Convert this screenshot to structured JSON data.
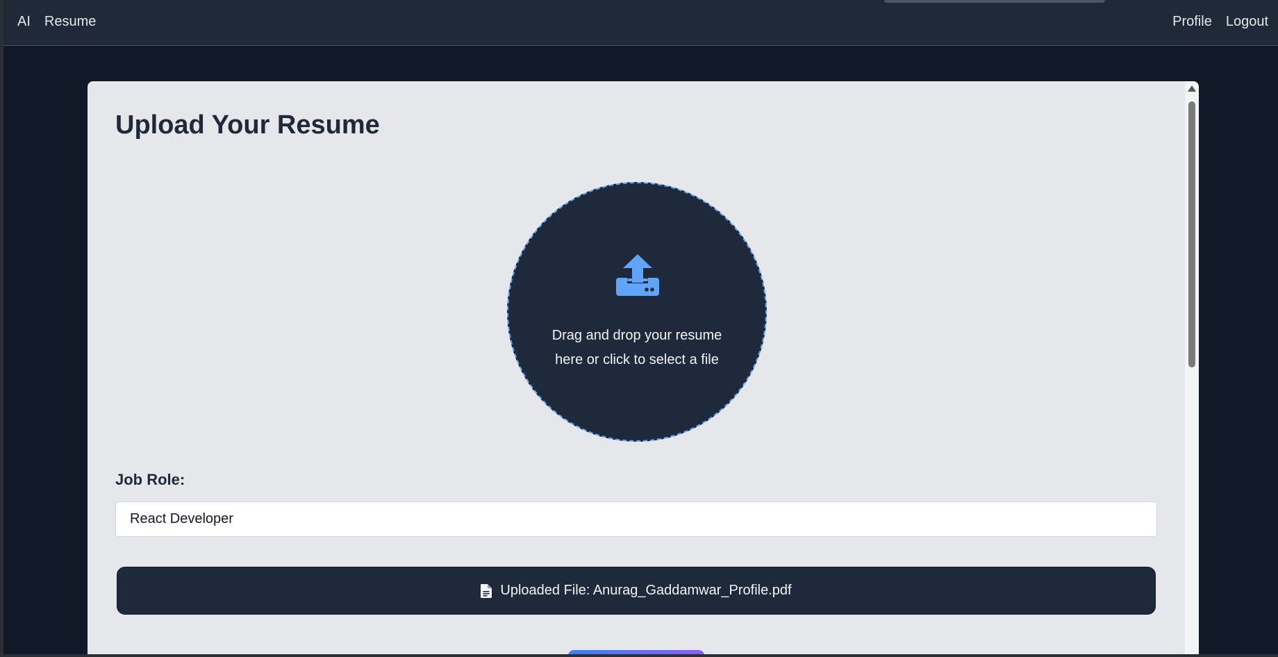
{
  "nav": {
    "left_items": [
      "AI",
      "Resume"
    ],
    "right_items": [
      "Profile",
      "Logout"
    ]
  },
  "page": {
    "title": "Upload Your Resume"
  },
  "dropzone": {
    "icon": "upload-tray-icon",
    "text": "Drag and drop your resume here or click to select a file",
    "accent_color": "#60a5fa"
  },
  "job_role": {
    "label": "Job Role:",
    "value": "React Developer"
  },
  "uploaded_file": {
    "icon": "document-icon",
    "text": "Uploaded File: Anurag_Gaddamwar_Profile.pdf"
  },
  "colors": {
    "background": "#111827",
    "navbar": "#1f2937",
    "card": "#e5e7eb",
    "dark_panel": "#1e293b",
    "accent": "#60a5fa"
  }
}
